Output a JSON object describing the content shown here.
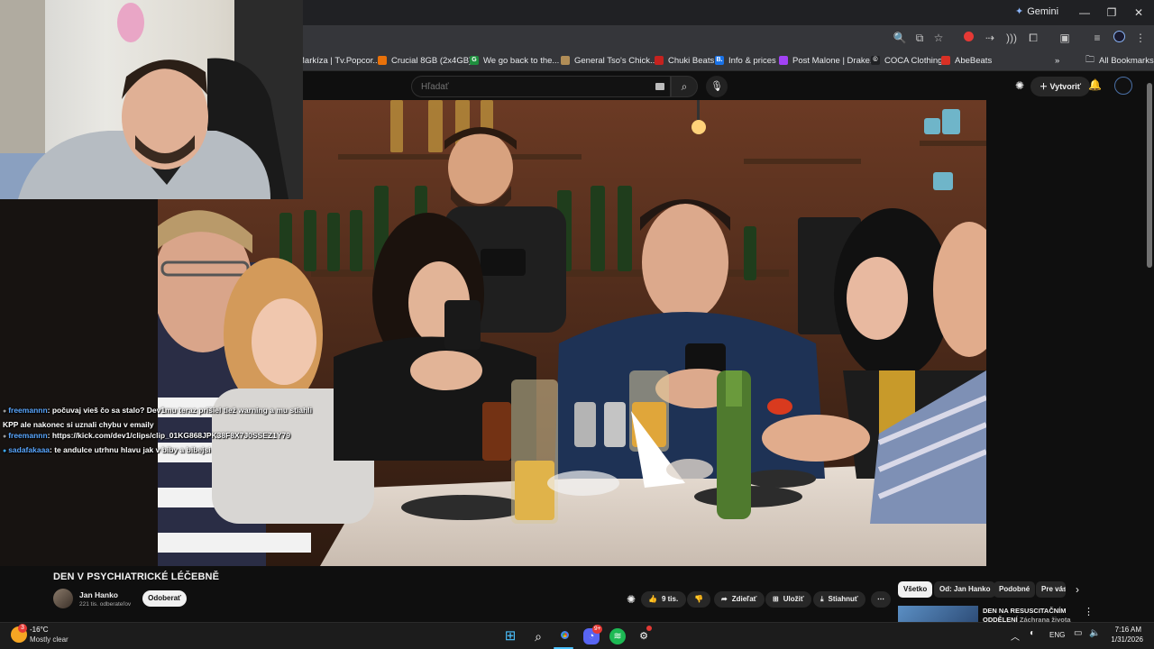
{
  "browser": {
    "gemini_label": "Gemini",
    "bookmarks": [
      {
        "label": "Markíza | Tv.Popcor...",
        "color": "#d93025"
      },
      {
        "label": "Crucial 8GB (2x4GB)...",
        "color": "#e8710a"
      },
      {
        "label": "We go back to the...",
        "color": "#1e8e3e"
      },
      {
        "label": "General Tso's Chick...",
        "color": "#b08d57"
      },
      {
        "label": "Chuki Beats",
        "color": "#c5221f"
      },
      {
        "label": "Info & prices",
        "color": "#1a73e8"
      },
      {
        "label": "Post Malone | Drake...",
        "color": "#a142f4"
      },
      {
        "label": "COCA Clothing",
        "color": "#202124"
      },
      {
        "label": "AbeBeats",
        "color": "#d93025"
      }
    ],
    "bookmark_glyphs": [
      "",
      "",
      "G",
      "",
      "",
      "B.",
      "",
      "©",
      ""
    ],
    "all_bookmarks_label": "All Bookmarks"
  },
  "youtube": {
    "search_placeholder": "Hľadať",
    "create_label": "Vytvoriť",
    "video_title": "DEN V PSYCHIATRICKÉ LÉČEBNĚ",
    "channel_name": "Jan Hanko",
    "subscribers": "221 tis. odberateľov",
    "subscribe_label": "Odoberať",
    "like_count": "9 tis.",
    "share_label": "Zdieľať",
    "save_label": "Uložiť",
    "download_label": "Stiahnuť",
    "chips": [
      "Všetko",
      "Od: Jan Hanko",
      "Podobné",
      "Pre vás"
    ],
    "rec_title": "DEN NA RESUSCITAČNÍM ODDĚLENÍ",
    "rec_title_cont": "Záchrana života"
  },
  "chat": [
    {
      "user": "freemannn",
      "text": ": počuvaj vieš čo sa stalo? Dev1mu teraz prišiel tiež warning a mu stiahli",
      "cont": "KPP ale nakonec si uznali chybu v emaily"
    },
    {
      "user": "freemannn",
      "text": ": https://kick.com/dev1/clips/clip_01KG868JPK38F8X7J0SSEZ1Y79",
      "cont": ""
    },
    {
      "user": "sadafakaaa",
      "text": ": te andulce utrhnu hlavu jak v biby a bibejsi",
      "cont": ""
    }
  ],
  "taskbar": {
    "temperature": "-16°C",
    "weather_desc": "Mostly clear",
    "weather_badge": "3",
    "discord_badge": "9+",
    "language": "ENG",
    "time": "7:16 AM",
    "date": "1/31/2026"
  },
  "colors": {
    "youtube_bg": "#0f0f0f",
    "chat_username": "#5aa7ff",
    "chrome_bar": "#35363a"
  }
}
